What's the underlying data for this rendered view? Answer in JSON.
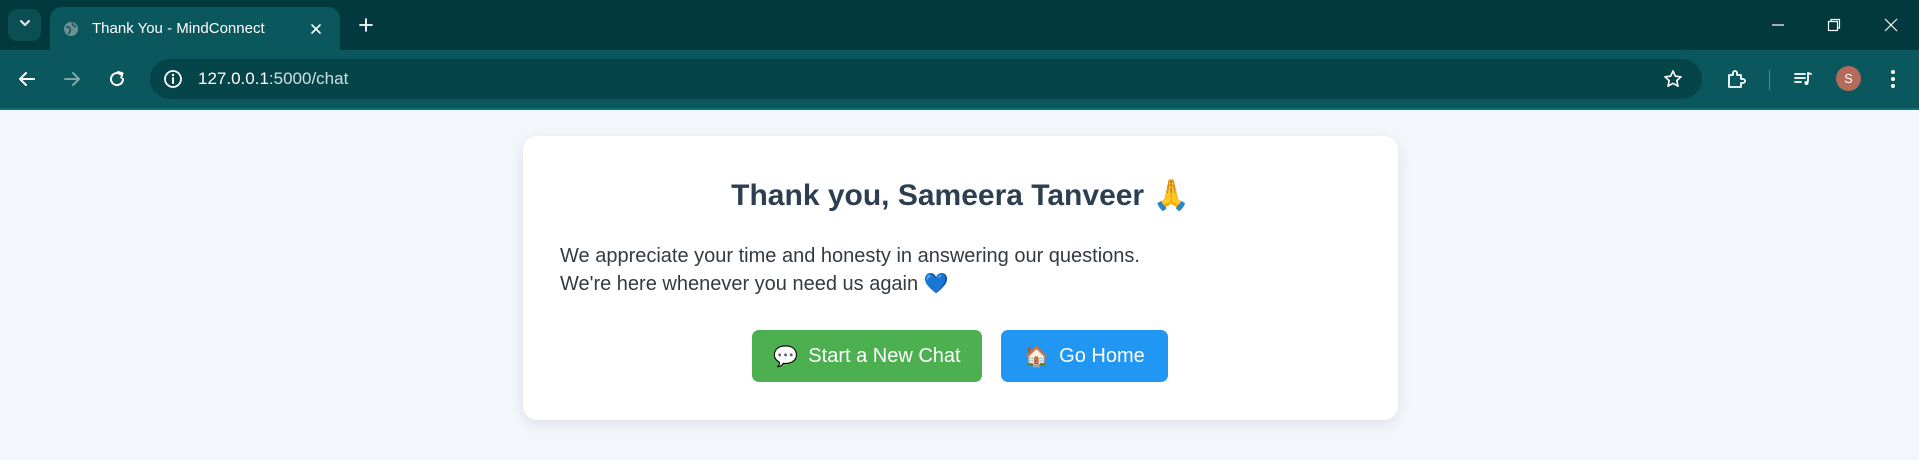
{
  "browser": {
    "tab": {
      "title": "Thank You - MindConnect"
    },
    "address_bar": {
      "host": "127.0.0.1",
      "path": ":5000/chat"
    },
    "profile_initial": "S",
    "icons": {
      "tab_search": "chevron-down-icon",
      "favicon": "globe-icon",
      "close": "close-icon",
      "new_tab": "plus-icon",
      "back": "arrow-left-icon",
      "forward": "arrow-right-icon",
      "reload": "reload-icon",
      "site_info": "info-icon",
      "bookmark": "star-icon",
      "extensions": "puzzle-icon",
      "media": "media-queue-icon",
      "menu": "kebab-menu-icon"
    },
    "colors": {
      "tabstrip": "#02393e",
      "toolbar": "#0a585d",
      "omnibox": "#054449"
    }
  },
  "page": {
    "title": "Thank you, Sameera Tanveer",
    "title_emoji": "🙏",
    "message_line1": "We appreciate your time and honesty in answering our questions.",
    "message_line2": "We're here whenever you need us again",
    "message_emoji": "💙",
    "buttons": {
      "new_chat": {
        "icon": "💬",
        "label": "Start a New Chat",
        "color": "#4caf50"
      },
      "go_home": {
        "icon": "🏠",
        "label": "Go Home",
        "color": "#2196f3"
      }
    }
  }
}
